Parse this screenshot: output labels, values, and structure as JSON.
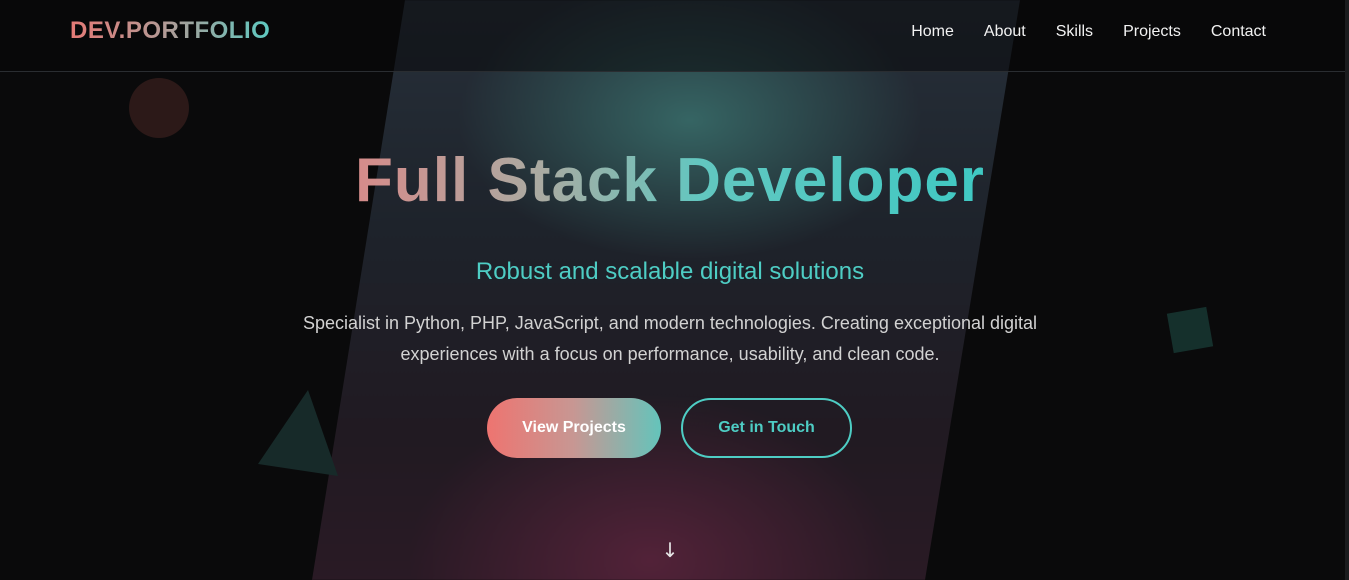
{
  "header": {
    "logo": "DEV.PORTFOLIO",
    "nav": [
      {
        "label": "Home"
      },
      {
        "label": "About"
      },
      {
        "label": "Skills"
      },
      {
        "label": "Projects"
      },
      {
        "label": "Contact"
      }
    ]
  },
  "hero": {
    "title": "Full Stack Developer",
    "subtitle": "Robust and scalable digital solutions",
    "description": "Specialist in Python, PHP, JavaScript, and modern technologies. Creating exceptional digital experiences with a focus on performance, usability, and clean code.",
    "primary_button": "View Projects",
    "secondary_button": "Get in Touch",
    "scroll_indicator": "↓"
  },
  "colors": {
    "accent_teal": "#4ecdc4",
    "accent_coral": "#ee7470",
    "background": "#0a0a0b"
  },
  "icons": {
    "scroll": "arrow-down-icon"
  }
}
